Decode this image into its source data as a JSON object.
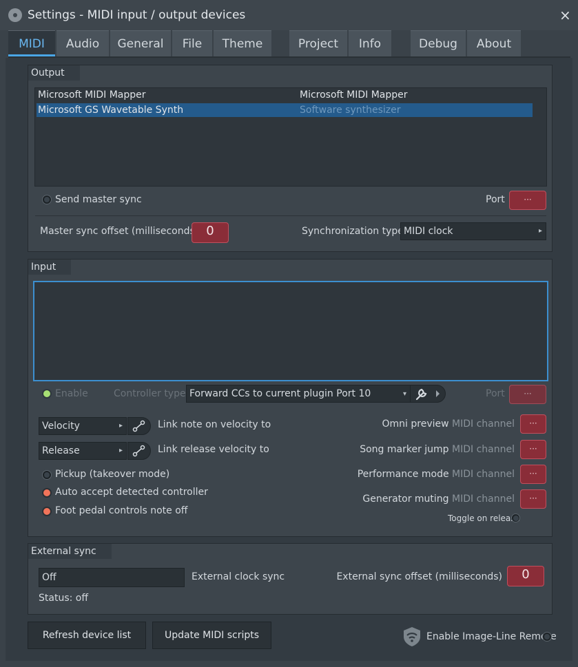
{
  "window": {
    "title": "Settings - MIDI input / output devices",
    "close_glyph": "×"
  },
  "tabs": [
    {
      "label": "MIDI",
      "active": true
    },
    {
      "label": "Audio"
    },
    {
      "label": "General"
    },
    {
      "label": "File"
    },
    {
      "label": "Theme"
    },
    {
      "label": "Project"
    },
    {
      "label": "Info"
    },
    {
      "label": "Debug"
    },
    {
      "label": "About"
    }
  ],
  "output": {
    "title": "Output",
    "devices": [
      {
        "name": "Microsoft MIDI Mapper",
        "type": "Microsoft MIDI Mapper",
        "selected": false
      },
      {
        "name": "Microsoft GS Wavetable Synth",
        "type": "Software synthesizer",
        "selected": true
      }
    ],
    "send_master_sync_label": "Send master sync",
    "port_label": "Port",
    "port_value": "···",
    "master_sync_offset_label": "Master sync offset (milliseconds)",
    "master_sync_offset_value": "0",
    "sync_type_label": "Synchronization type",
    "sync_type_value": "MIDI clock"
  },
  "input": {
    "title": "Input",
    "enable_label": "Enable",
    "controller_type_label": "Controller type",
    "controller_type_value": "Forward CCs to current plugin Port 10",
    "port_label": "Port",
    "port_value": "···",
    "velocity_value": "Velocity",
    "link_velocity_label": "Link note on velocity to",
    "release_value": "Release",
    "link_release_label": "Link release velocity to",
    "pickup_label": "Pickup (takeover mode)",
    "auto_accept_label": "Auto accept detected controller",
    "foot_pedal_label": "Foot pedal controls note off",
    "omni_preview_label": "Omni preview",
    "song_marker_label": "Song marker jump",
    "performance_mode_label": "Performance mode",
    "generator_muting_label": "Generator muting",
    "midi_channel_suffix": "MIDI channel",
    "channel_value": "···",
    "toggle_on_release_label": "Toggle on release"
  },
  "external_sync": {
    "title": "External sync",
    "clock_value": "Off",
    "clock_label": "External clock sync",
    "offset_label": "External sync offset (milliseconds)",
    "offset_value": "0",
    "status": "Status: off"
  },
  "footer": {
    "refresh_label": "Refresh device list",
    "update_scripts_label": "Update MIDI scripts",
    "remote_label": "Enable Image-Line Remote"
  },
  "colors": {
    "accent": "#4aa6e6",
    "selection": "#245b8c",
    "red_control": "#8a2d38",
    "orange_led": "#f2745a",
    "green_led": "#a8e074"
  },
  "icons": {
    "title": "fl-studio-icon",
    "link": "link-icon",
    "wrench": "wrench-icon",
    "remote": "wifi-shield-icon"
  }
}
